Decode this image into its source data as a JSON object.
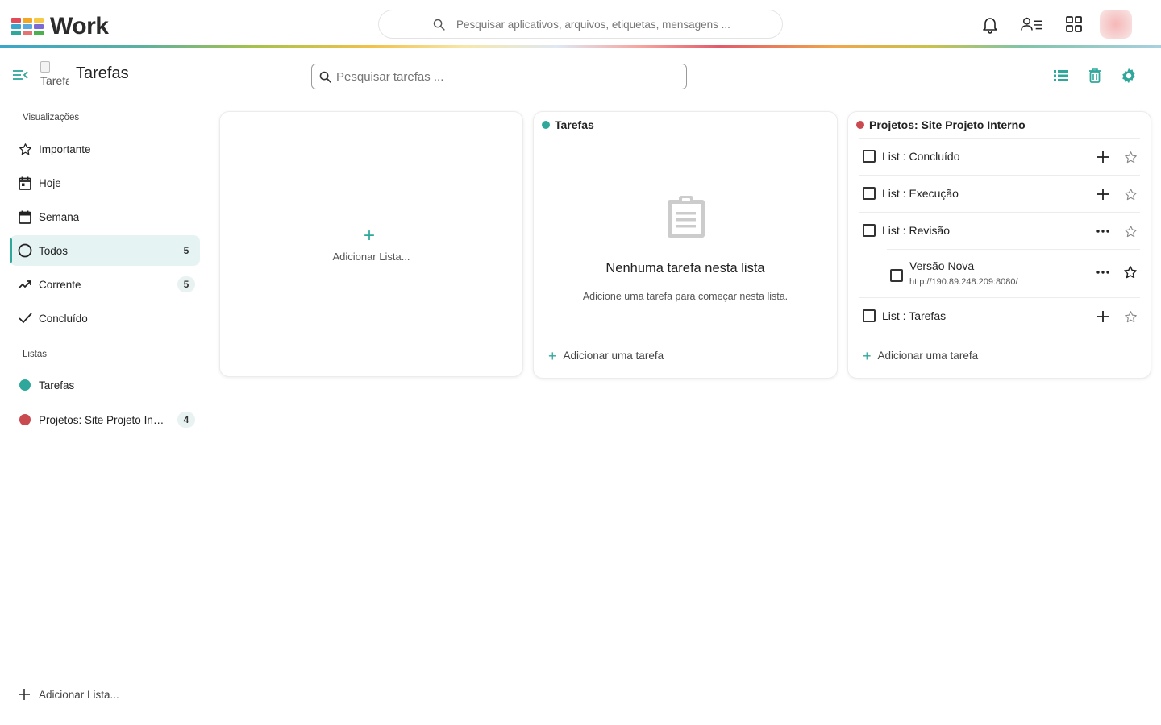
{
  "topbar": {
    "app_name": "Work",
    "search_placeholder": "Pesquisar aplicativos, arquivos, etiquetas, mensagens ...",
    "logo_colors": [
      "#e24b5a",
      "#f5a623",
      "#f6c945",
      "#3aa6c9",
      "#5aa8e0",
      "#7b6ad6",
      "#2fa89b",
      "#e57373",
      "#4caf50"
    ]
  },
  "app": {
    "title": "Tarefas",
    "logo_alt": "Tarefas",
    "search_placeholder": "Pesquisar tarefas ...",
    "accent_color": "#2fa89b"
  },
  "sidebar": {
    "views_label": "Visualizações",
    "views": [
      {
        "label": "Importante",
        "icon": "star-icon",
        "count": null
      },
      {
        "label": "Hoje",
        "icon": "calendar-day-icon",
        "count": null
      },
      {
        "label": "Semana",
        "icon": "calendar-week-icon",
        "count": null
      },
      {
        "label": "Todos",
        "icon": "circle-icon",
        "count": "5",
        "active": true
      },
      {
        "label": "Corrente",
        "icon": "trending-icon",
        "count": "5"
      },
      {
        "label": "Concluído",
        "icon": "check-icon",
        "count": null
      }
    ],
    "lists_label": "Listas",
    "lists": [
      {
        "label": "Tarefas",
        "color": "#2fa89b",
        "count": null
      },
      {
        "label": "Projetos: Site Projeto Interno",
        "color": "#c94a4f",
        "count": "4"
      }
    ],
    "add_list_label": "Adicionar Lista..."
  },
  "cards": {
    "add_list": {
      "label": "Adicionar Lista..."
    },
    "tarefas": {
      "title": "Tarefas",
      "color": "#2fa89b",
      "empty_title": "Nenhuma tarefa nesta lista",
      "empty_sub": "Adicione uma tarefa para começar nesta lista.",
      "add_task_label": "Adicionar uma tarefa"
    },
    "projeto": {
      "title": "Projetos: Site Projeto Interno",
      "color": "#c94a4f",
      "tasks": [
        {
          "label": "List : Concluído",
          "action": "plus-icon",
          "starred": false
        },
        {
          "label": "List : Execução",
          "action": "plus-icon",
          "starred": false
        },
        {
          "label": "List : Revisão",
          "action": "more-icon",
          "starred": false
        },
        {
          "label": "Versão Nova",
          "sub": "http://190.89.248.209:8080/",
          "action": "more-icon",
          "starred": true,
          "subtask": true
        },
        {
          "label": "List : Tarefas",
          "action": "plus-icon",
          "starred": false
        }
      ],
      "add_task_label": "Adicionar uma tarefa"
    }
  }
}
